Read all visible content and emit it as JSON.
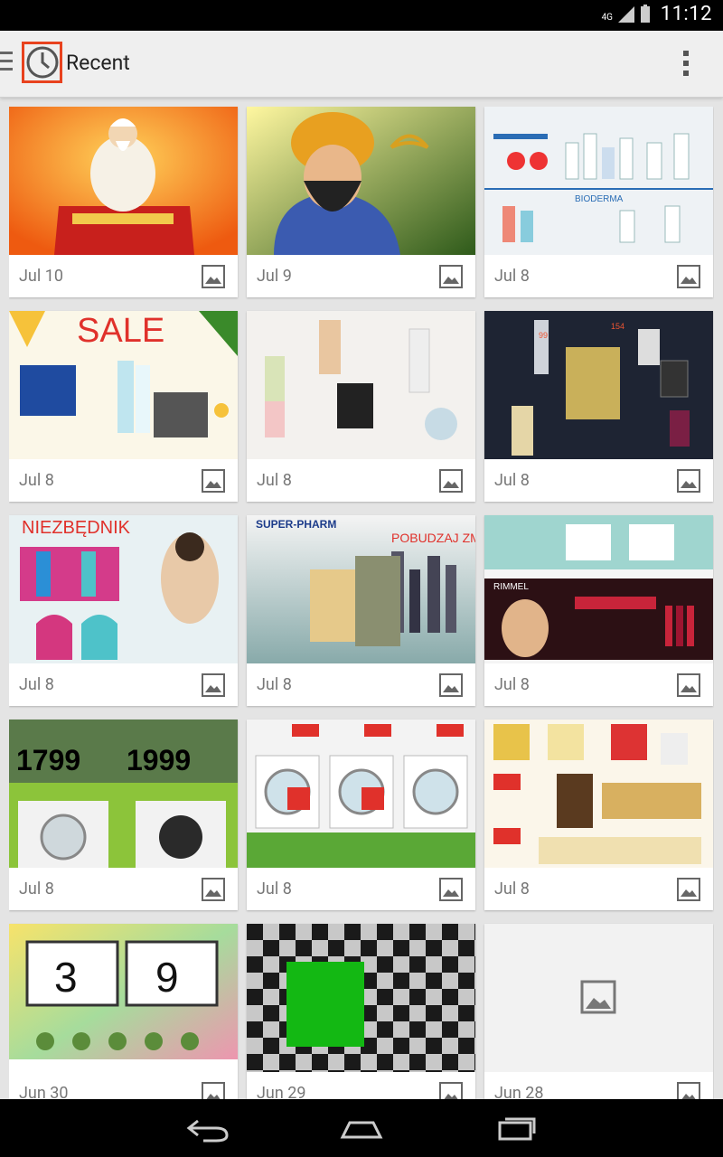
{
  "status": {
    "time": "11:12",
    "network": "4G"
  },
  "actionbar": {
    "title": "Recent"
  },
  "thumbnails": [
    {
      "date": "Jul 10"
    },
    {
      "date": "Jul 9"
    },
    {
      "date": "Jul 8"
    },
    {
      "date": "Jul 8",
      "text": "SALE"
    },
    {
      "date": "Jul 8"
    },
    {
      "date": "Jul 8"
    },
    {
      "date": "Jul 8",
      "text": "NIEZBĘDNIK"
    },
    {
      "date": "Jul 8",
      "text": "SUPER-PHARM",
      "text2": "POBUDZAJ ZMYSŁY"
    },
    {
      "date": "Jul 8",
      "text": "RIMMEL"
    },
    {
      "date": "Jul 8",
      "text": "1799",
      "text2": "1999"
    },
    {
      "date": "Jul 8"
    },
    {
      "date": "Jul 8"
    },
    {
      "date": "Jun 30",
      "text": "3",
      "text2": "9"
    },
    {
      "date": "Jun 29"
    },
    {
      "date": "Jun 28"
    }
  ]
}
